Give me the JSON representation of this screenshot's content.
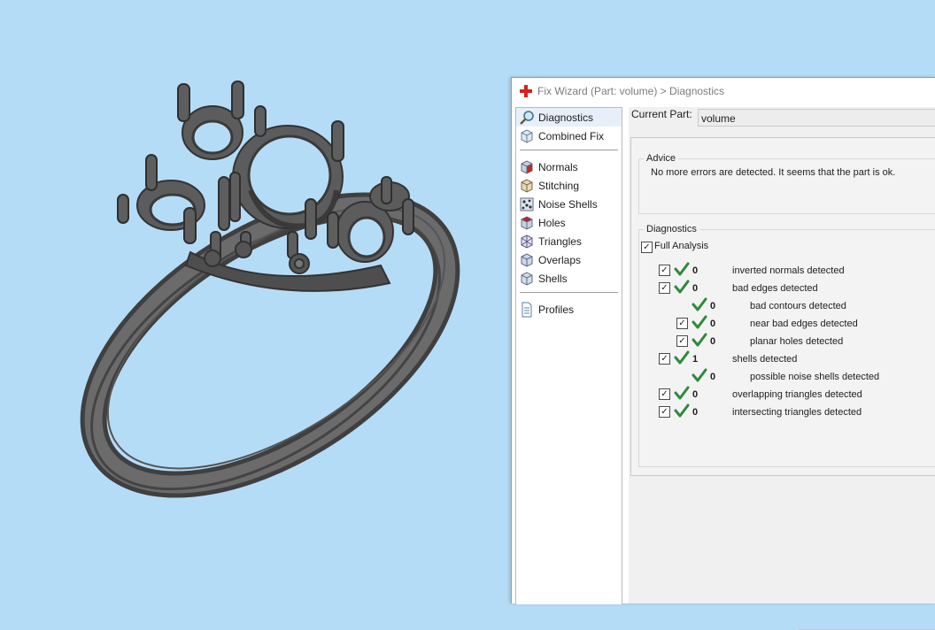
{
  "window": {
    "title": "Fix Wizard (Part: volume) > Diagnostics"
  },
  "nav": {
    "top_items": [
      {
        "label": "Diagnostics",
        "icon": "magnifier-icon",
        "selected": true
      },
      {
        "label": "Combined Fix",
        "icon": "cube-icon"
      }
    ],
    "fix_items": [
      {
        "label": "Normals",
        "icon": "normals-cube-icon"
      },
      {
        "label": "Stitching",
        "icon": "stitching-cube-icon"
      },
      {
        "label": "Noise Shells",
        "icon": "noise-shells-icon"
      },
      {
        "label": "Holes",
        "icon": "holes-cube-icon"
      },
      {
        "label": "Triangles",
        "icon": "triangles-icon"
      },
      {
        "label": "Overlaps",
        "icon": "overlaps-cube-icon"
      },
      {
        "label": "Shells",
        "icon": "shells-cube-icon"
      }
    ],
    "bottom_items": [
      {
        "label": "Profiles",
        "icon": "document-icon"
      }
    ]
  },
  "content": {
    "current_part_label": "Current Part:",
    "current_part_value": "volume",
    "advice": {
      "title": "Advice",
      "text": "No more errors are detected. It seems that the part is ok."
    },
    "diagnostics": {
      "title": "Diagnostics",
      "full_analysis_label": "Full Analysis",
      "full_analysis_checked": true,
      "rows": [
        {
          "checkbox": true,
          "indent": 0,
          "count": "0",
          "label": "inverted normals detected"
        },
        {
          "checkbox": true,
          "indent": 0,
          "count": "0",
          "label": "bad edges detected"
        },
        {
          "checkbox": false,
          "indent": 1,
          "count": "0",
          "label": "bad contours detected"
        },
        {
          "checkbox": true,
          "indent": 1,
          "count": "0",
          "label": "near bad edges detected"
        },
        {
          "checkbox": true,
          "indent": 1,
          "count": "0",
          "label": "planar holes detected"
        },
        {
          "checkbox": true,
          "indent": 0,
          "count": "1",
          "label": "shells detected"
        },
        {
          "checkbox": false,
          "indent": 1,
          "count": "0",
          "label": "possible noise shells detected"
        },
        {
          "checkbox": true,
          "indent": 0,
          "count": "0",
          "label": "overlapping triangles detected"
        },
        {
          "checkbox": true,
          "indent": 0,
          "count": "0",
          "label": "intersecting triangles detected"
        }
      ]
    }
  },
  "colors": {
    "viewport_background": "#b5dcf7",
    "model": "#5a5a5a",
    "check_green": "#2e8b3a",
    "title_icon_red": "#d6211f"
  }
}
